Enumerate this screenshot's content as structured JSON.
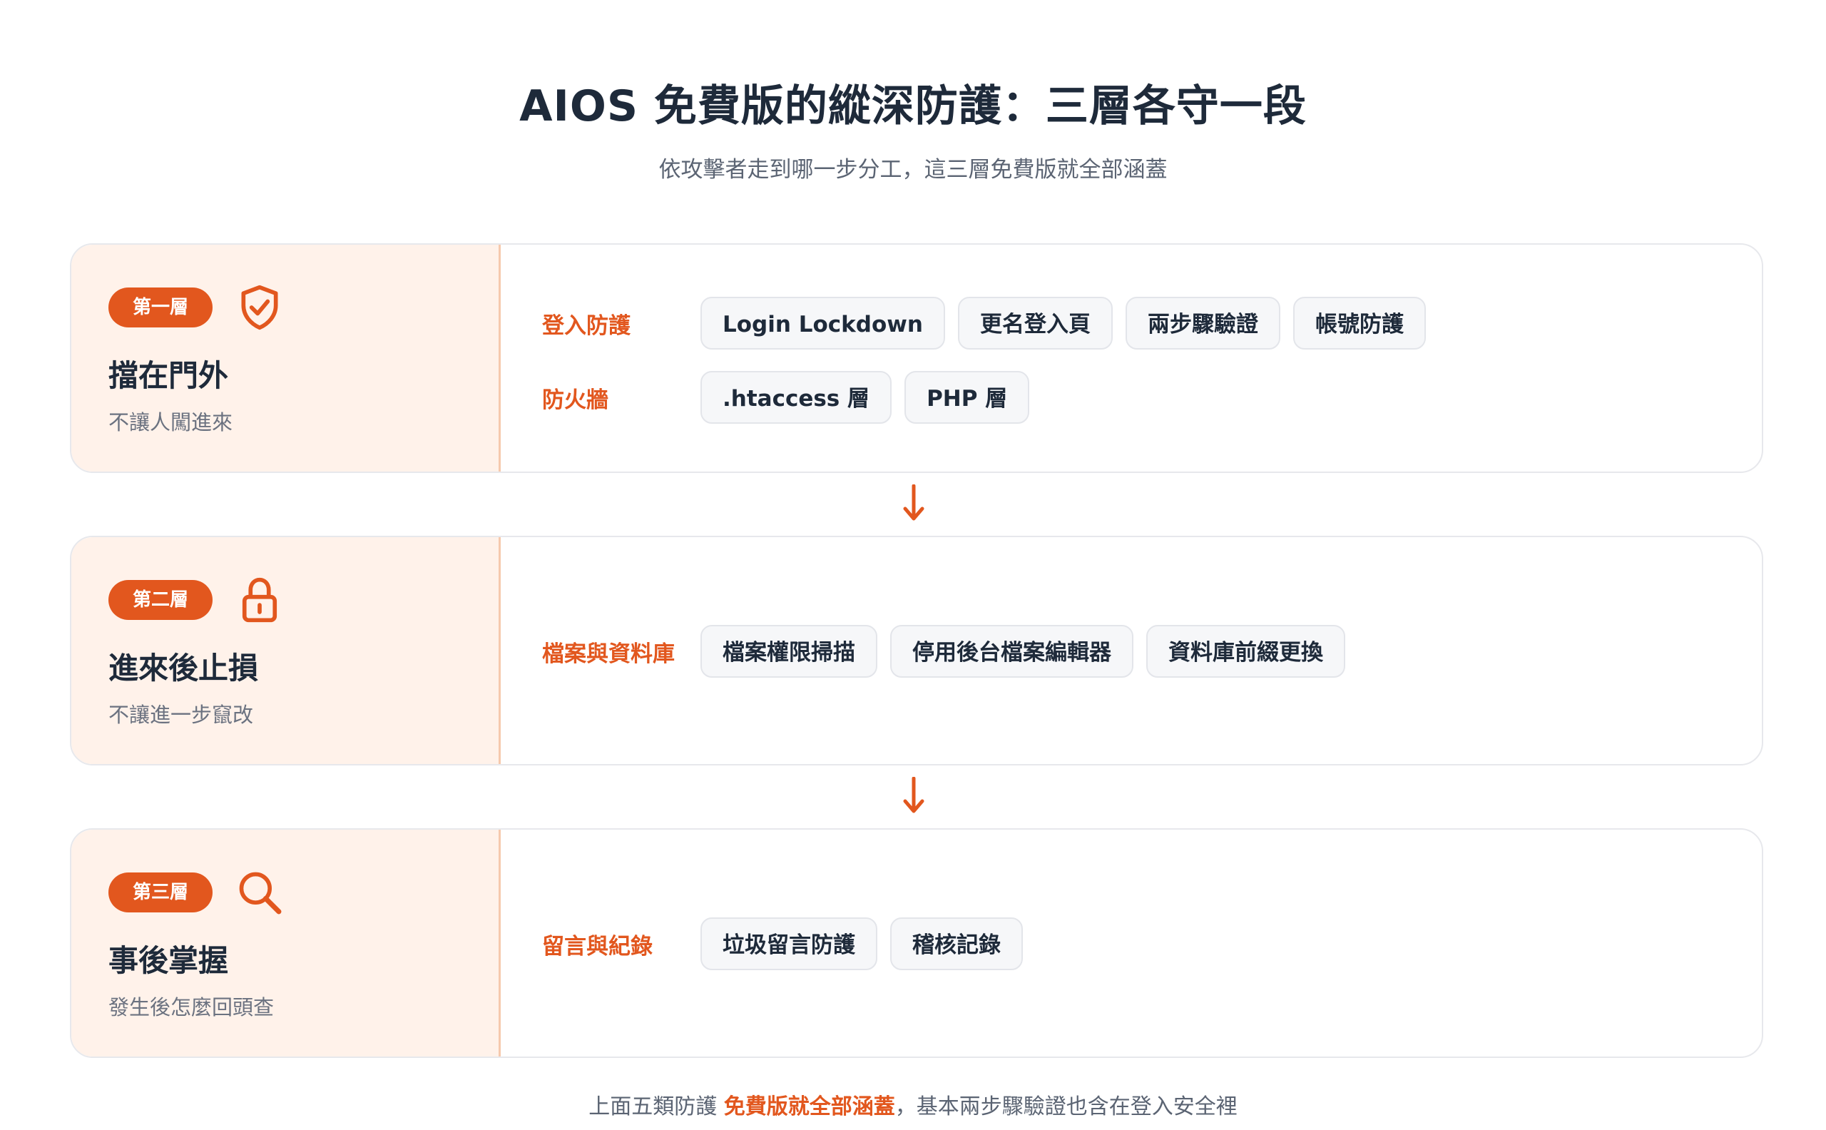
{
  "title": "AIOS 免費版的縱深防護：三層各守一段",
  "subtitle": "依攻擊者走到哪一步分工，這三層免費版就全部涵蓋",
  "colors": {
    "accent": "#e2571e",
    "left_panel_bg": "#fff2ea",
    "chip_bg": "#f6f7f9",
    "text_dark": "#1e2a3a",
    "text_muted": "#6b7280"
  },
  "layers": [
    {
      "badge": "第一層",
      "icon": "shield-check-icon",
      "heading": "擋在門外",
      "description": "不讓人闖進來",
      "rows": [
        {
          "label": "登入防護",
          "chips": [
            "Login Lockdown",
            "更名登入頁",
            "兩步驟驗證",
            "帳號防護"
          ]
        },
        {
          "label": "防火牆",
          "chips": [
            ".htaccess 層",
            "PHP 層"
          ]
        }
      ]
    },
    {
      "badge": "第二層",
      "icon": "lock-icon",
      "heading": "進來後止損",
      "description": "不讓進一步竄改",
      "rows": [
        {
          "label": "檔案與資料庫",
          "chips": [
            "檔案權限掃描",
            "停用後台檔案編輯器",
            "資料庫前綴更換"
          ]
        }
      ]
    },
    {
      "badge": "第三層",
      "icon": "search-icon",
      "heading": "事後掌握",
      "description": "發生後怎麼回頭查",
      "rows": [
        {
          "label": "留言與紀錄",
          "chips": [
            "垃圾留言防護",
            "稽核記錄"
          ]
        }
      ]
    }
  ],
  "footer": {
    "before": "上面五類防護 ",
    "highlight": "免費版就全部涵蓋",
    "after": "，基本兩步驟驗證也含在登入安全裡"
  }
}
